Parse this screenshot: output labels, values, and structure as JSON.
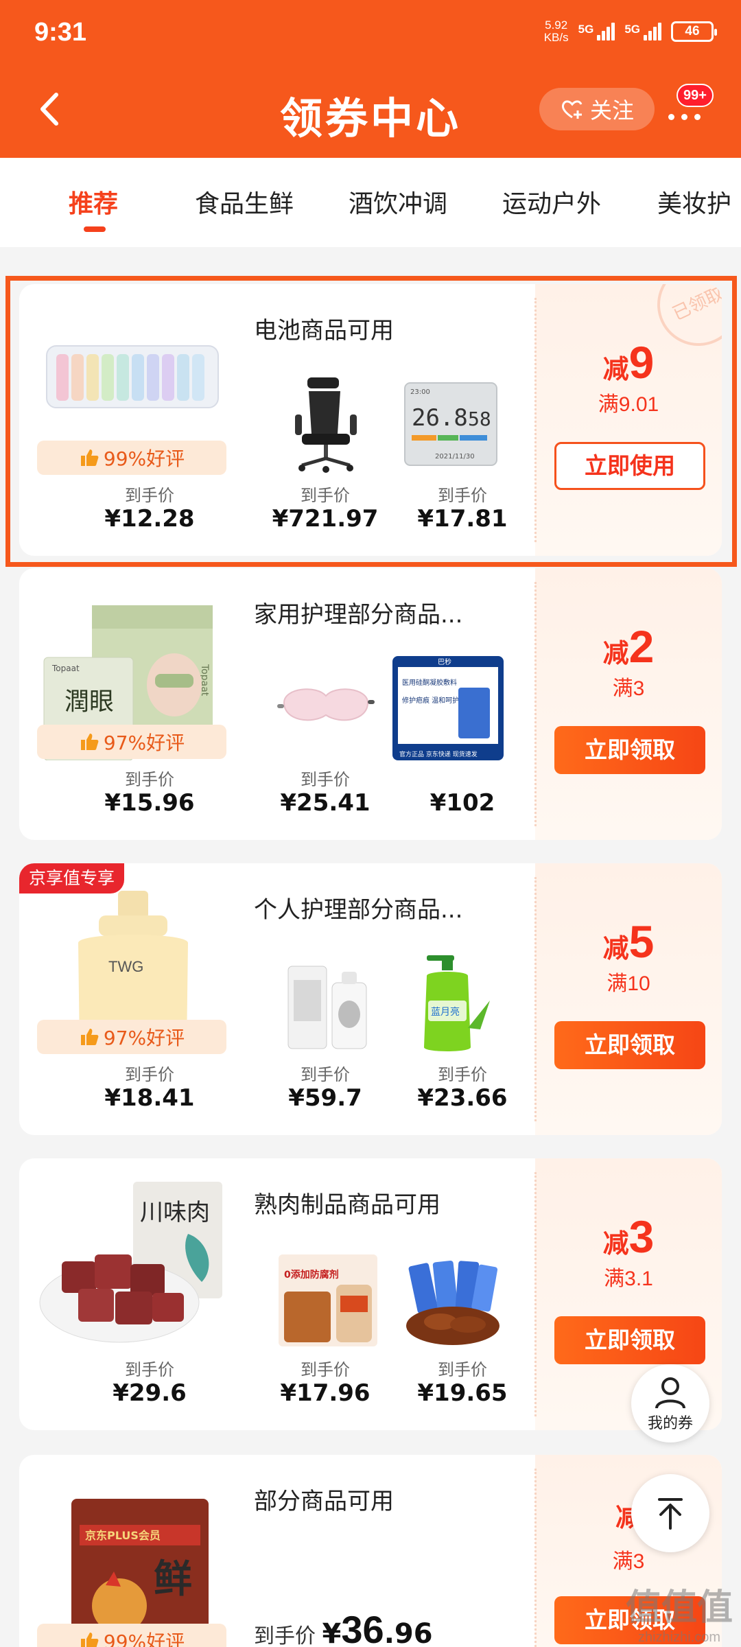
{
  "status_bar": {
    "time": "9:31",
    "net_speed_value": "5.92",
    "net_speed_unit": "KB/s",
    "signal1_label": "5G",
    "signal2_label": "5G",
    "battery": "46"
  },
  "header": {
    "title": "领券中心",
    "follow_label": "关注",
    "badge": "99+"
  },
  "tabs": [
    {
      "label": "推荐"
    },
    {
      "label": "食品生鲜"
    },
    {
      "label": "酒饮冲调"
    },
    {
      "label": "运动户外"
    },
    {
      "label": "美妆护"
    }
  ],
  "cards": [
    {
      "title": "电池商品可用",
      "rating": "99%好评",
      "price_label": "到手价",
      "prices": [
        "¥12.28",
        "¥721.97",
        "¥17.81"
      ],
      "reduce_prefix": "减",
      "reduce_amount": "9",
      "threshold": "满9.01",
      "button": "立即使用",
      "stamp": "已领取",
      "thermo_temp": "26.8",
      "thermo_hum": "58",
      "thermo_time": "23:00",
      "thermo_date": "2021/11/30"
    },
    {
      "title": "家用护理部分商品...",
      "rating": "97%好评",
      "price_label": "到手价",
      "prices": [
        "¥15.96",
        "¥25.41",
        "¥102"
      ],
      "reduce_prefix": "减",
      "reduce_amount": "2",
      "threshold": "满3",
      "button": "立即领取",
      "box_brand": "Topaat",
      "box_text": "潤眼",
      "ad_top": "巴秒",
      "ad_title": "医用硅酮凝胶敷料",
      "ad_sub": "修护疤痕 温和呵护",
      "ad_footer": "官方正品 京东快递 现货速发"
    },
    {
      "title": "个人护理部分商品...",
      "rating": "97%好评",
      "price_label": "到手价",
      "prices": [
        "¥18.41",
        "¥59.7",
        "¥23.66"
      ],
      "reduce_prefix": "减",
      "reduce_amount": "5",
      "threshold": "满10",
      "button": "立即领取",
      "vip_tag": "京享值专享",
      "jar_brand": "TWG",
      "soap_brand": "蓝月亮"
    },
    {
      "title": "熟肉制品商品可用",
      "price_label": "到手价",
      "prices": [
        "¥29.6",
        "¥17.96",
        "¥19.65"
      ],
      "reduce_prefix": "减",
      "reduce_amount": "3",
      "threshold": "满3.1",
      "button": "立即领取",
      "bag_text": "川味肉",
      "jar_label": "0添加防腐剂"
    },
    {
      "title": "部分商品可用",
      "rating": "99%好评",
      "price_label": "到手价",
      "big_price_symbol": "¥",
      "big_price_int": "36",
      "big_price_dec": ".96",
      "reduce_prefix": "减",
      "threshold": "满3",
      "button": "立即领取",
      "pack_brand": "京东PLUS会员",
      "pack_char": "鲜"
    }
  ],
  "floating": {
    "coupon_label": "我的券"
  },
  "watermark": {
    "line1": "值值值",
    "line2": "zhizhizhi.com"
  },
  "colors": {
    "brand": "#f6581c",
    "accent_red": "#f5331c"
  }
}
